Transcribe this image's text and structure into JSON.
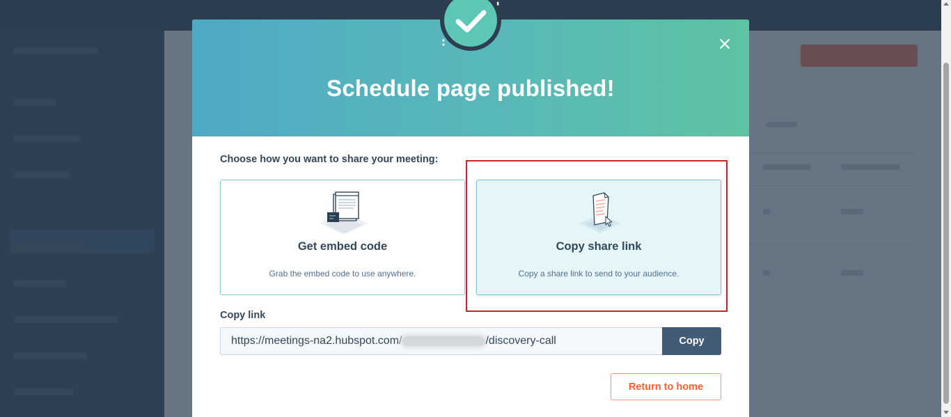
{
  "modal": {
    "title": "Schedule page published!",
    "close_icon": "close-icon",
    "badge_icon": "checkmark-icon"
  },
  "share": {
    "prompt": "Choose how you want to share your meeting:",
    "options": [
      {
        "title": "Get embed code",
        "description": "Grab the embed code to use anywhere.",
        "icon": "embed-code-illustration",
        "selected": false
      },
      {
        "title": "Copy share link",
        "description": "Copy a share link to send to your audience.",
        "icon": "share-link-illustration",
        "selected": true
      }
    ]
  },
  "copy_link": {
    "label": "Copy link",
    "url_prefix": "https://meetings-na2.hubspot.com/",
    "url_suffix": "/discovery-call",
    "copy_label": "Copy"
  },
  "footer": {
    "return_label": "Return to home"
  },
  "colors": {
    "header_start": "#4fa9c4",
    "header_end": "#5ec2a3",
    "primary_button": "#425b76",
    "accent_orange": "#ff5c35",
    "highlight_red": "#d0201f"
  }
}
